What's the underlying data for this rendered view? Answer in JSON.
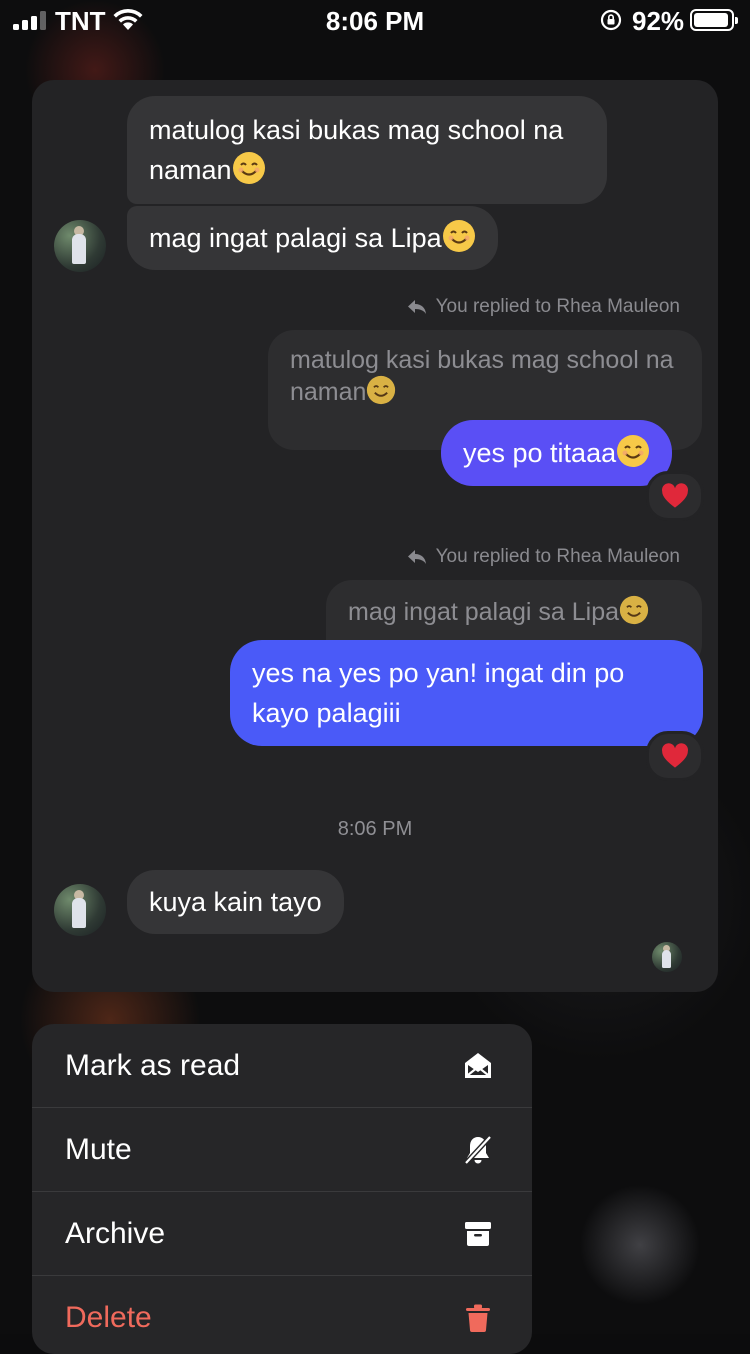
{
  "status_bar": {
    "carrier": "TNT",
    "time": "8:06 PM",
    "battery_percent": "92%",
    "battery_level": 0.92
  },
  "chat": {
    "incoming_1": {
      "text": "matulog kasi bukas mag school na naman"
    },
    "incoming_2": {
      "text": "mag ingat palagi sa Lipa"
    },
    "reply_1": {
      "note": "You replied to Rhea Mauleon",
      "quoted": "matulog kasi bukas mag school na naman",
      "text": "yes po titaaa",
      "reaction": "❤️"
    },
    "reply_2": {
      "note": "You replied to Rhea Mauleon",
      "quoted": "mag ingat palagi sa Lipa",
      "text": "yes na yes po yan! ingat din po kayo palagiii",
      "reaction": "❤️"
    },
    "timestamp": "8:06 PM",
    "incoming_3": {
      "text": "kuya kain tayo"
    }
  },
  "colors": {
    "outgoing_bubble_1": "#5a4ff5",
    "outgoing_bubble_2": "#4a5af8",
    "delete": "#f06a5c"
  },
  "menu": {
    "items": [
      {
        "label": "Mark as read",
        "icon": "envelope-open-icon"
      },
      {
        "label": "Mute",
        "icon": "bell-slash-icon"
      },
      {
        "label": "Archive",
        "icon": "archive-box-icon"
      },
      {
        "label": "Delete",
        "icon": "trash-icon"
      }
    ]
  }
}
